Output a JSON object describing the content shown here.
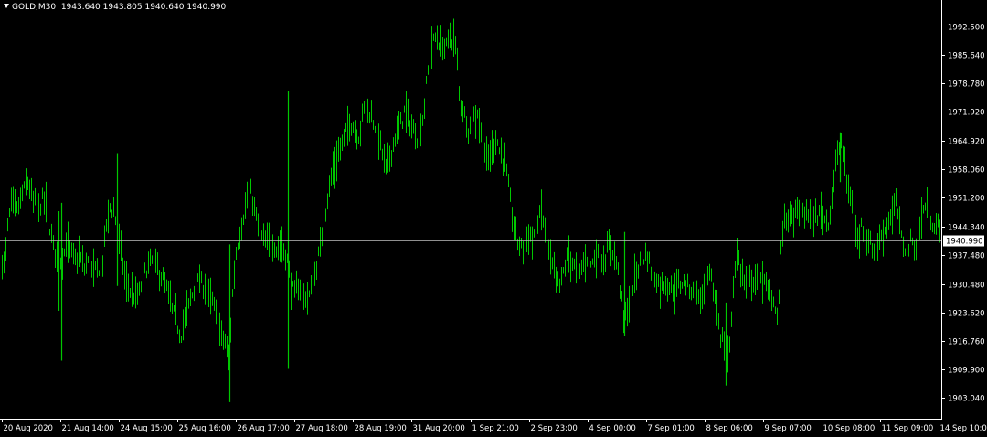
{
  "header": {
    "symbol": "GOLD,M30",
    "open": "1943.640",
    "high": "1943.805",
    "low": "1940.640",
    "close": "1940.990"
  },
  "colors": {
    "background": "#000000",
    "candle": "#00c800",
    "axis": "#ffffff",
    "price_line": "#c0c0c0",
    "price_box": "#ffffff"
  },
  "icons": {
    "menu": "triangle-down-icon"
  },
  "chart_data": {
    "type": "bar",
    "title": "",
    "ylim": [
      1898.0,
      1998.0
    ],
    "current_price": 1940.99,
    "current_price_label": "1940.990",
    "y_ticks": [
      {
        "label": "1992.500",
        "value": 1992.5
      },
      {
        "label": "1985.640",
        "value": 1985.64
      },
      {
        "label": "1978.780",
        "value": 1978.78
      },
      {
        "label": "1971.920",
        "value": 1971.92
      },
      {
        "label": "1964.920",
        "value": 1964.92
      },
      {
        "label": "1958.060",
        "value": 1958.06
      },
      {
        "label": "1951.200",
        "value": 1951.2
      },
      {
        "label": "1944.340",
        "value": 1944.34
      },
      {
        "label": "1937.480",
        "value": 1937.48
      },
      {
        "label": "1930.480",
        "value": 1930.48
      },
      {
        "label": "1923.620",
        "value": 1923.62
      },
      {
        "label": "1916.760",
        "value": 1916.76
      },
      {
        "label": "1909.900",
        "value": 1909.9
      },
      {
        "label": "1903.040",
        "value": 1903.04
      }
    ],
    "x_ticks": [
      "20 Aug 2020",
      "21 Aug 14:00",
      "24 Aug 15:00",
      "25 Aug 16:00",
      "26 Aug 17:00",
      "27 Aug 18:00",
      "28 Aug 19:00",
      "31 Aug 20:00",
      "1 Sep 21:00",
      "2 Sep 23:00",
      "4 Sep 00:00",
      "7 Sep 01:00",
      "8 Sep 06:00",
      "9 Sep 07:00",
      "10 Sep 08:00",
      "11 Sep 09:00",
      "14 Sep 10:00"
    ],
    "path": [
      [
        0,
        1936
      ],
      [
        3,
        1935
      ],
      [
        6,
        1944
      ],
      [
        10,
        1950
      ],
      [
        16,
        1948
      ],
      [
        22,
        1952
      ],
      [
        28,
        1955
      ],
      [
        34,
        1950
      ],
      [
        40,
        1949
      ],
      [
        46,
        1951
      ],
      [
        50,
        1947
      ],
      [
        55,
        1940
      ],
      [
        60,
        1938
      ],
      [
        65,
        1936
      ],
      [
        70,
        1940
      ],
      [
        75,
        1938
      ],
      [
        80,
        1936
      ],
      [
        85,
        1937
      ],
      [
        90,
        1934
      ],
      [
        95,
        1936
      ],
      [
        100,
        1933
      ],
      [
        105,
        1934
      ],
      [
        110,
        1936
      ],
      [
        114,
        1945
      ],
      [
        118,
        1949
      ],
      [
        122,
        1948
      ],
      [
        126,
        1944
      ],
      [
        130,
        1938
      ],
      [
        135,
        1931
      ],
      [
        140,
        1929
      ],
      [
        145,
        1927
      ],
      [
        150,
        1928
      ],
      [
        155,
        1933
      ],
      [
        160,
        1935
      ],
      [
        165,
        1936
      ],
      [
        170,
        1934
      ],
      [
        175,
        1932
      ],
      [
        180,
        1929
      ],
      [
        185,
        1925
      ],
      [
        190,
        1922
      ],
      [
        195,
        1918
      ],
      [
        200,
        1922
      ],
      [
        205,
        1926
      ],
      [
        210,
        1929
      ],
      [
        215,
        1931
      ],
      [
        220,
        1930
      ],
      [
        225,
        1928
      ],
      [
        230,
        1926
      ],
      [
        235,
        1922
      ],
      [
        240,
        1918
      ],
      [
        245,
        1916
      ],
      [
        248,
        1912
      ],
      [
        252,
        1928
      ],
      [
        256,
        1938
      ],
      [
        260,
        1943
      ],
      [
        265,
        1948
      ],
      [
        270,
        1953
      ],
      [
        275,
        1950
      ],
      [
        280,
        1944
      ],
      [
        285,
        1941
      ],
      [
        290,
        1940
      ],
      [
        295,
        1941
      ],
      [
        300,
        1939
      ],
      [
        305,
        1940
      ],
      [
        310,
        1938
      ],
      [
        313,
        1935
      ],
      [
        316,
        1930
      ],
      [
        320,
        1928
      ],
      [
        325,
        1930
      ],
      [
        330,
        1928
      ],
      [
        335,
        1927
      ],
      [
        340,
        1930
      ],
      [
        345,
        1936
      ],
      [
        350,
        1942
      ],
      [
        355,
        1950
      ],
      [
        360,
        1956
      ],
      [
        365,
        1960
      ],
      [
        370,
        1963
      ],
      [
        375,
        1966
      ],
      [
        380,
        1970
      ],
      [
        385,
        1968
      ],
      [
        390,
        1966
      ],
      [
        395,
        1972
      ],
      [
        400,
        1973
      ],
      [
        405,
        1970
      ],
      [
        410,
        1968
      ],
      [
        415,
        1963
      ],
      [
        420,
        1958
      ],
      [
        425,
        1962
      ],
      [
        430,
        1966
      ],
      [
        435,
        1968
      ],
      [
        440,
        1972
      ],
      [
        445,
        1970
      ],
      [
        450,
        1967
      ],
      [
        455,
        1966
      ],
      [
        460,
        1970
      ],
      [
        465,
        1980
      ],
      [
        470,
        1988
      ],
      [
        475,
        1990
      ],
      [
        480,
        1988
      ],
      [
        485,
        1987
      ],
      [
        490,
        1990
      ],
      [
        495,
        1989
      ],
      [
        498,
        1984
      ],
      [
        500,
        1976
      ],
      [
        505,
        1972
      ],
      [
        510,
        1968
      ],
      [
        515,
        1970
      ],
      [
        520,
        1972
      ],
      [
        525,
        1965
      ],
      [
        530,
        1960
      ],
      [
        535,
        1962
      ],
      [
        540,
        1966
      ],
      [
        545,
        1962
      ],
      [
        550,
        1960
      ],
      [
        553,
        1955
      ],
      [
        556,
        1950
      ],
      [
        560,
        1944
      ],
      [
        565,
        1940
      ],
      [
        570,
        1939
      ],
      [
        575,
        1943
      ],
      [
        580,
        1941
      ],
      [
        585,
        1945
      ],
      [
        590,
        1948
      ],
      [
        595,
        1942
      ],
      [
        600,
        1936
      ],
      [
        605,
        1932
      ],
      [
        610,
        1930
      ],
      [
        615,
        1934
      ],
      [
        620,
        1938
      ],
      [
        625,
        1935
      ],
      [
        630,
        1932
      ],
      [
        635,
        1935
      ],
      [
        640,
        1937
      ],
      [
        645,
        1935
      ],
      [
        650,
        1938
      ],
      [
        655,
        1936
      ],
      [
        660,
        1937
      ],
      [
        665,
        1940
      ],
      [
        670,
        1938
      ],
      [
        675,
        1932
      ],
      [
        680,
        1922
      ],
      [
        685,
        1925
      ],
      [
        690,
        1930
      ],
      [
        695,
        1934
      ],
      [
        700,
        1936
      ],
      [
        705,
        1938
      ],
      [
        710,
        1934
      ],
      [
        715,
        1932
      ],
      [
        720,
        1930
      ],
      [
        725,
        1931
      ],
      [
        730,
        1930
      ],
      [
        735,
        1929
      ],
      [
        740,
        1930
      ],
      [
        745,
        1931
      ],
      [
        750,
        1930
      ],
      [
        755,
        1929
      ],
      [
        760,
        1928
      ],
      [
        765,
        1927
      ],
      [
        770,
        1930
      ],
      [
        775,
        1933
      ],
      [
        778,
        1929
      ],
      [
        782,
        1925
      ],
      [
        786,
        1918
      ],
      [
        790,
        1916
      ],
      [
        793,
        1912
      ],
      [
        796,
        1915
      ],
      [
        800,
        1930
      ],
      [
        803,
        1938
      ],
      [
        806,
        1936
      ],
      [
        810,
        1932
      ],
      [
        815,
        1930
      ],
      [
        820,
        1932
      ],
      [
        825,
        1931
      ],
      [
        830,
        1933
      ],
      [
        835,
        1930
      ],
      [
        840,
        1928
      ],
      [
        845,
        1926
      ],
      [
        849,
        1922
      ],
      [
        852,
        1938
      ],
      [
        855,
        1946
      ],
      [
        860,
        1947
      ],
      [
        865,
        1946
      ],
      [
        870,
        1948
      ],
      [
        875,
        1946
      ],
      [
        880,
        1948
      ],
      [
        885,
        1947
      ],
      [
        890,
        1946
      ],
      [
        895,
        1948
      ],
      [
        900,
        1946
      ],
      [
        905,
        1946
      ],
      [
        908,
        1952
      ],
      [
        911,
        1958
      ],
      [
        915,
        1962
      ],
      [
        918,
        1965
      ],
      [
        921,
        1960
      ],
      [
        925,
        1954
      ],
      [
        930,
        1950
      ],
      [
        933,
        1944
      ],
      [
        937,
        1940
      ],
      [
        940,
        1945
      ],
      [
        945,
        1942
      ],
      [
        950,
        1940
      ],
      [
        955,
        1938
      ],
      [
        960,
        1941
      ],
      [
        965,
        1943
      ],
      [
        970,
        1946
      ],
      [
        975,
        1948
      ],
      [
        978,
        1950
      ],
      [
        981,
        1946
      ],
      [
        985,
        1940
      ],
      [
        990,
        1939
      ],
      [
        995,
        1941
      ],
      [
        1000,
        1939
      ],
      [
        1005,
        1945
      ],
      [
        1010,
        1950
      ],
      [
        1015,
        1946
      ],
      [
        1020,
        1945
      ],
      [
        1025,
        1944
      ],
      [
        1028,
        1941
      ]
    ],
    "spikes": [
      {
        "x": 62,
        "high": 1948,
        "low": 1924
      },
      {
        "x": 65,
        "high": 1950,
        "low": 1912
      },
      {
        "x": 126,
        "high": 1962,
        "low": 1930
      },
      {
        "x": 249,
        "high": 1940,
        "low": 1902
      },
      {
        "x": 313,
        "high": 1977,
        "low": 1910
      },
      {
        "x": 681,
        "high": 1943,
        "low": 1918
      },
      {
        "x": 792,
        "high": 1926,
        "low": 1906
      },
      {
        "x": 917,
        "high": 1967,
        "low": 1955
      }
    ]
  }
}
